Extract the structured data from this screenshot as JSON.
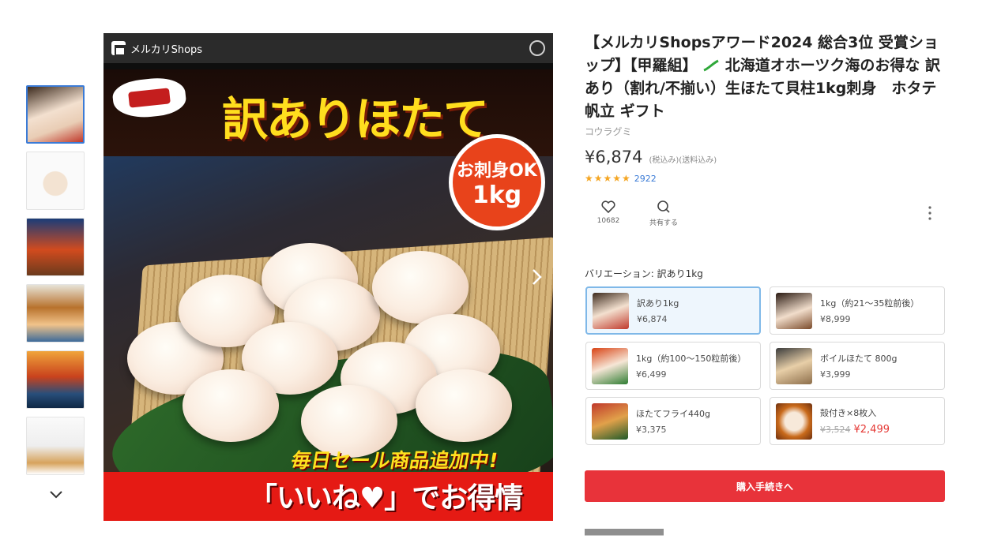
{
  "hero": {
    "shop_bar_label": "メルカリShops",
    "banner_title": "訳ありほたて",
    "badge_line1": "お刺身OK",
    "badge_line2": "1kg",
    "sale_line": "毎日セール商品追加中!",
    "iine_line": "「いいね♥」でお得情報!"
  },
  "product": {
    "title": "【メルカリShopsアワード2024 総合3位 受賞ショップ】【甲羅組】",
    "title_rest": "北海道オホーツク海のお得な 訳あり（割れ/不揃い）生ほたて貝柱1kg刺身　ホタテ　帆立 ギフト",
    "shop_name": "コウラグミ",
    "price": "¥6,874",
    "tax_note": "(税込み)(送料込み)",
    "stars": "★★★★★",
    "review_count": "2922",
    "like_count": "10682",
    "share_label": "共有する"
  },
  "variation": {
    "label": "バリエーション: 訳あり1kg",
    "options": [
      {
        "name": "訳あり1kg",
        "price": "¥6,874"
      },
      {
        "name": "1kg（約21〜35粒前後）",
        "price": "¥8,999"
      },
      {
        "name": "1kg（約100〜150粒前後）",
        "price": "¥6,499"
      },
      {
        "name": "ボイルほたて 800g",
        "price": "¥3,999"
      },
      {
        "name": "ほたてフライ440g",
        "price": "¥3,375"
      },
      {
        "name": "殻付き×8枚入",
        "price_old": "¥3,524",
        "price": "¥2,499"
      }
    ]
  },
  "buy_button": "購入手続きへ",
  "colors": {
    "accent_red": "#e8333a",
    "link_blue": "#3b7bd6",
    "star": "#f5a623"
  }
}
